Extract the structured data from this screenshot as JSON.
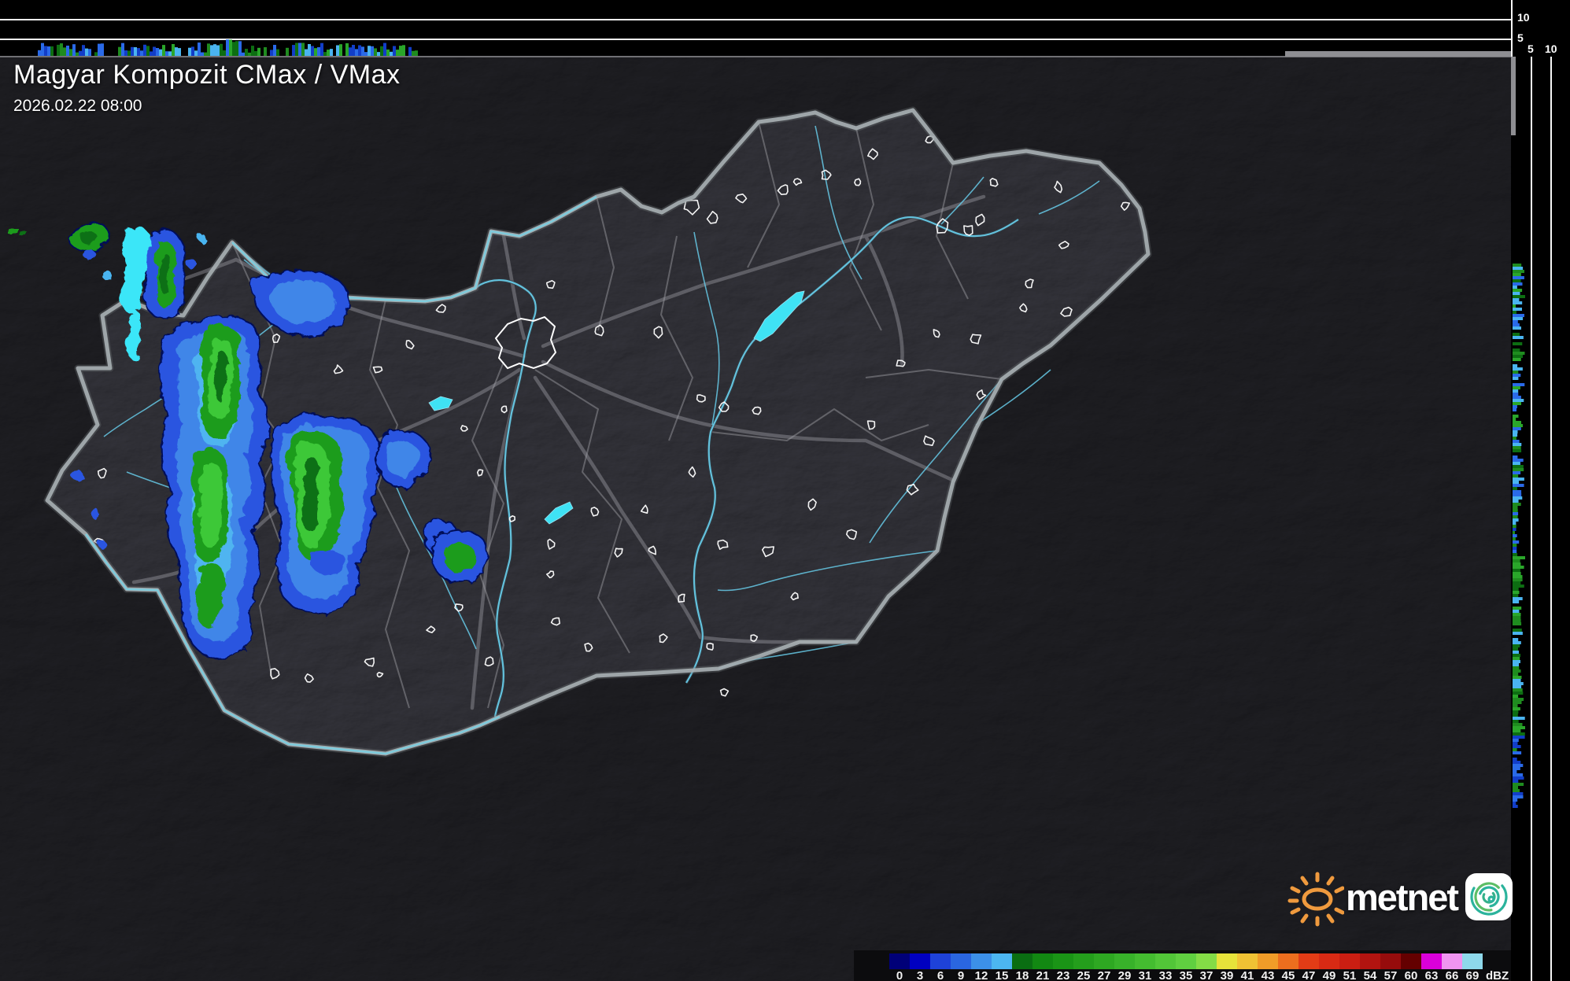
{
  "header": {
    "title": "Magyar Kompozit CMax / VMax",
    "timestamp": "2026.02.22 08:00"
  },
  "panels": {
    "top": {
      "km_labels": [
        "10",
        "5"
      ]
    },
    "right": {
      "km_labels": [
        "5",
        "10"
      ]
    }
  },
  "legend": {
    "unit": "dBZ",
    "ticks": [
      "0",
      "3",
      "6",
      "9",
      "12",
      "15",
      "18",
      "21",
      "23",
      "25",
      "27",
      "29",
      "31",
      "33",
      "35",
      "37",
      "39",
      "41",
      "43",
      "45",
      "47",
      "49",
      "51",
      "54",
      "57",
      "60",
      "63",
      "66",
      "69"
    ],
    "colors": [
      "#000078",
      "#0000c0",
      "#1e42d8",
      "#2a66e0",
      "#3c90e8",
      "#4cb6f0",
      "#0a6e12",
      "#128812",
      "#1a9416",
      "#249e1c",
      "#2ea822",
      "#38b22a",
      "#44bc30",
      "#52c638",
      "#60d040",
      "#84dc46",
      "#e6e23a",
      "#f0c234",
      "#f09c28",
      "#ec6e1e",
      "#e23c16",
      "#d82a14",
      "#ca1e12",
      "#b21410",
      "#960c0c",
      "#640000",
      "#da00da",
      "#f094f0",
      "#8ed8ea"
    ]
  },
  "branding": {
    "wordmark": "metnet",
    "sun_color": "#ef9a3e",
    "spiral_teal": "#2bb39c",
    "spiral_green": "#5cbe66"
  },
  "map_colors": {
    "terrain_inside": "#47474d",
    "terrain_outside": "#2a2a2e",
    "country_border": "#a9b0b4",
    "river": "#66c9e6",
    "lake": "#3fe2f4",
    "road": "#a0a0a8",
    "settlement_outline": "#ffffff"
  }
}
